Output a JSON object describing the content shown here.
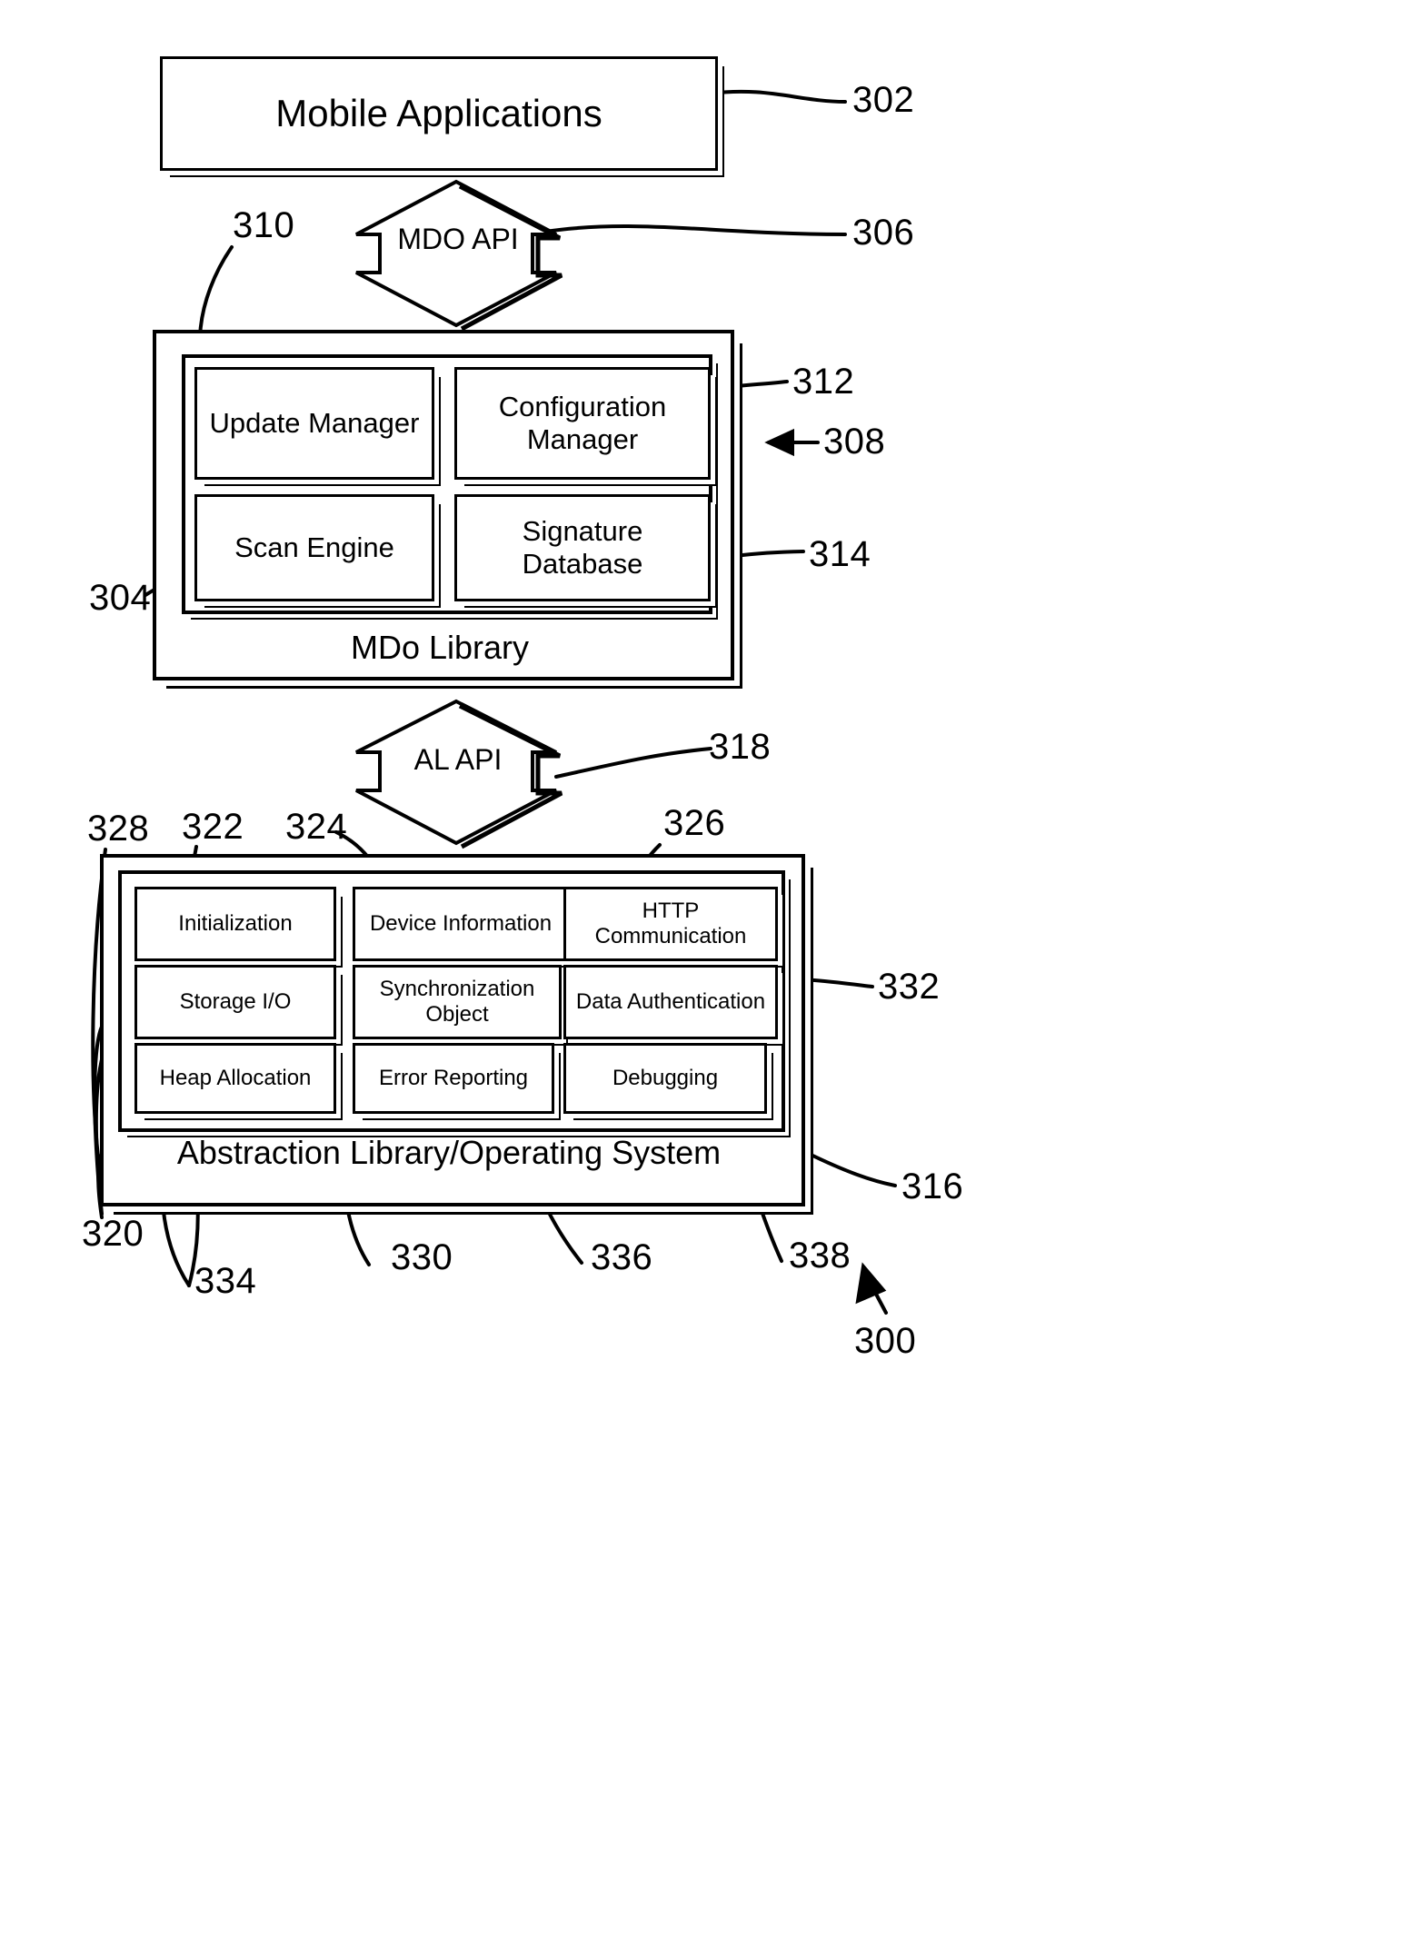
{
  "figure": {
    "number": "300",
    "top_block": {
      "label": "Mobile Applications",
      "ref": "302"
    },
    "api_top": {
      "label": "MDO API",
      "ref": "306"
    },
    "api_bottom": {
      "label": "AL API",
      "ref": "318"
    },
    "mdo_library": {
      "title": "MDo Library",
      "ref_outer": "308",
      "ref_inner": "304",
      "cells": [
        {
          "label": "Update Manager",
          "ref": "310"
        },
        {
          "label": "Configuration Manager",
          "ref": "312"
        },
        {
          "label": "Scan Engine",
          "ref": ""
        },
        {
          "label": "Signature Database",
          "ref": "314"
        }
      ]
    },
    "abstraction_library": {
      "title": "Abstraction Library/Operating System",
      "ref_outer": "316",
      "ref_inner": "320",
      "ref_edge": "328",
      "cells": [
        {
          "label": "Initialization",
          "ref": "322"
        },
        {
          "label": "Device Information",
          "ref": "324"
        },
        {
          "label": "HTTP Communication",
          "ref": "326"
        },
        {
          "label": "Storage I/O",
          "ref": ""
        },
        {
          "label": "Synchronization Object",
          "ref": "330"
        },
        {
          "label": "Data Authentication",
          "ref": "332"
        },
        {
          "label": "Heap Allocation",
          "ref": "334"
        },
        {
          "label": "Error Reporting",
          "ref": "336"
        },
        {
          "label": "Debugging",
          "ref": "338"
        }
      ]
    },
    "reference_numerals": [
      "302",
      "306",
      "310",
      "312",
      "308",
      "304",
      "314",
      "318",
      "328",
      "322",
      "324",
      "326",
      "332",
      "320",
      "334",
      "330",
      "336",
      "338",
      "316",
      "300"
    ]
  }
}
